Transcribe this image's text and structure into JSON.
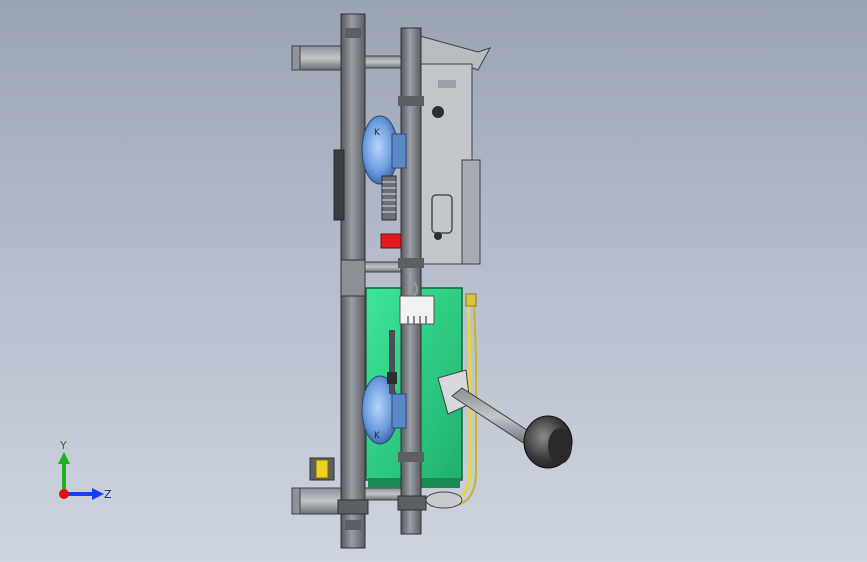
{
  "viewport": {
    "background_top": "#9aa3b4",
    "background_bottom": "#cfd5df"
  },
  "triad": {
    "y_label": "Y",
    "z_label": "Z",
    "y_color": "#20b020",
    "z_color": "#1a3cff",
    "x_color": "#e01010"
  },
  "colors": {
    "steel": "#7b7f85",
    "steel_dark": "#4c4f54",
    "steel_light": "#a9adb3",
    "blue_motor": "#6f9fe0",
    "green_panel": "#2fd98a",
    "yellow_wire": "#e8d640",
    "red_part": "#e01a1a",
    "white_connector": "#f2f2f2"
  }
}
